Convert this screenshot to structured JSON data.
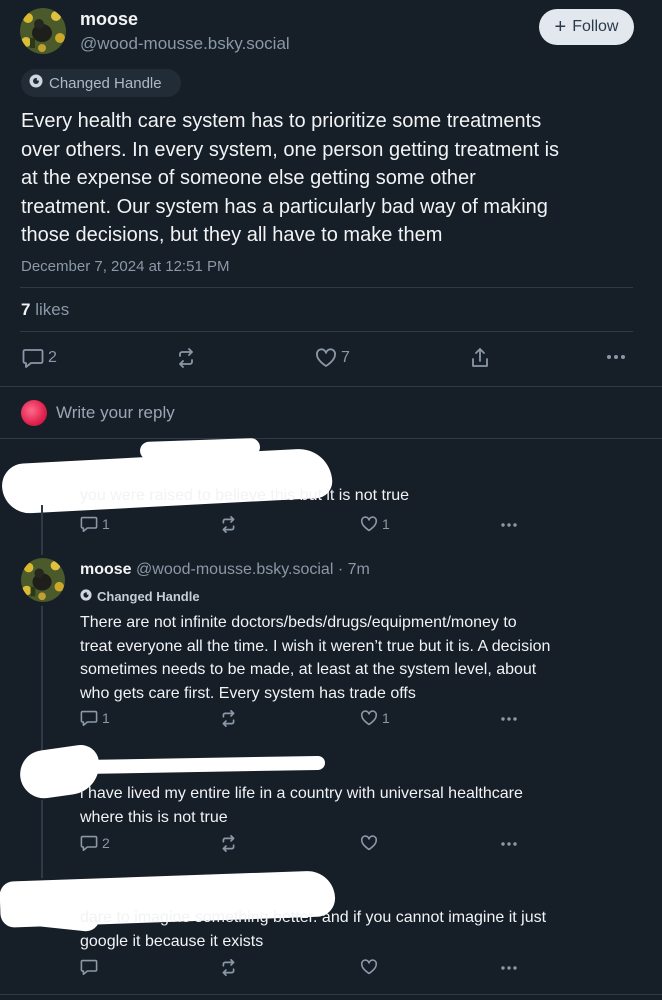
{
  "main_post": {
    "display_name": "moose",
    "handle": "@wood-mousse.bsky.social",
    "follow_label": "Follow",
    "badge_label": "Changed Handle",
    "text_lines": [
      "Every health care system has to prioritize some treatments",
      "over others. In every system, one person getting treatment is",
      "at the expense of someone else getting some other",
      "treatment. Our system has a particularly bad way of making",
      "those decisions, but they all have to make them"
    ],
    "timestamp": "December 7, 2024 at 12:51 PM",
    "likes_count": "7",
    "likes_word": "likes",
    "reply_count": "2",
    "like_count": "7"
  },
  "composer": {
    "placeholder": "Write your reply"
  },
  "replies": [
    {
      "text_lines": [
        "you were raised to believe this but it is not true"
      ],
      "reply_count": "1",
      "like_count": "1"
    },
    {
      "display_name": "moose",
      "handle": "@wood-mousse.bsky.social",
      "age": "· 7m",
      "badge_label": "Changed Handle",
      "text_lines": [
        "There are not infinite doctors/beds/drugs/equipment/money to",
        "treat everyone all the time. I wish it weren’t true but it is. A decision",
        "sometimes needs to be made, at least at the system level, about",
        "who gets care first. Every system has trade offs"
      ],
      "reply_count": "1",
      "like_count": "1"
    },
    {
      "text_lines": [
        "i have lived my entire life in a country with universal healthcare",
        "where this is not true"
      ],
      "reply_count": "2",
      "like_count": ""
    },
    {
      "text_lines": [
        "dare to imagine something better. and if you cannot imagine it just",
        "google it because it exists"
      ],
      "reply_count": "",
      "like_count": ""
    }
  ],
  "colors": {
    "background": "#161e27",
    "text": "#f1f3f5",
    "muted": "#8a98a8",
    "divider": "#2e3a47",
    "follow_bg": "#e3e8ee",
    "follow_text": "#2b3a4a"
  },
  "icons": [
    "reply-icon",
    "repost-icon",
    "like-icon",
    "share-icon",
    "more-icon",
    "plus-icon",
    "changed-handle-icon"
  ]
}
